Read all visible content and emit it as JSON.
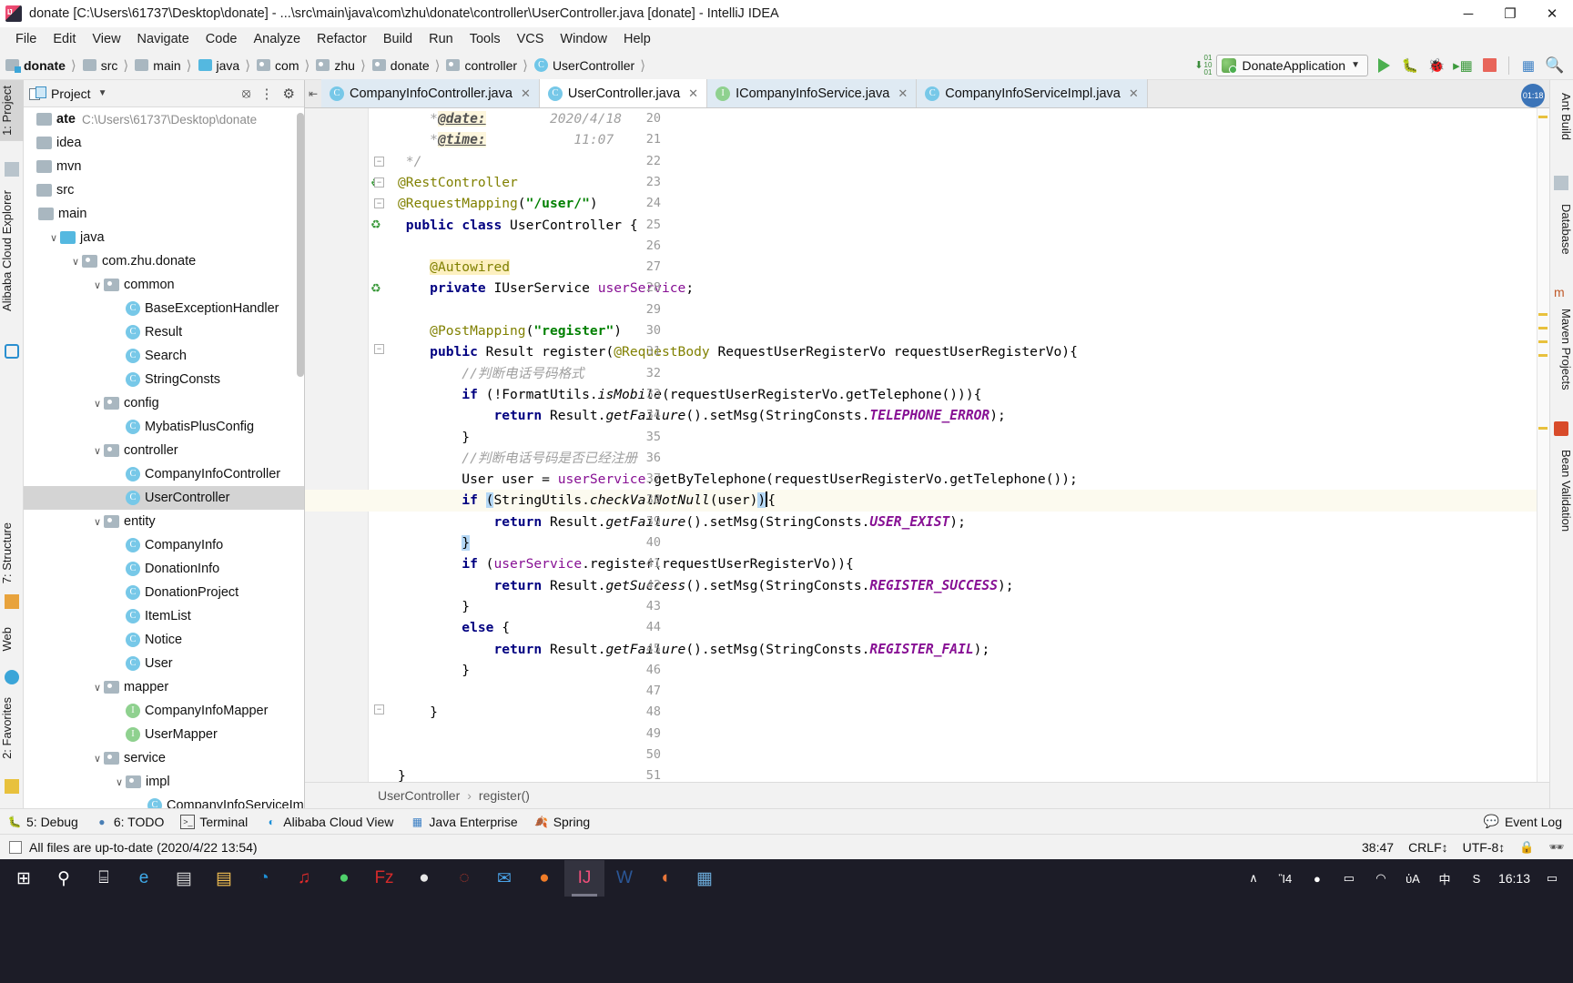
{
  "window": {
    "title": "donate [C:\\Users\\61737\\Desktop\\donate] - ...\\src\\main\\java\\com\\zhu\\donate\\controller\\UserController.java [donate] - IntelliJ IDEA",
    "minimize": "─",
    "maximize": "❐",
    "close": "✕"
  },
  "menu": [
    {
      "label": "File"
    },
    {
      "label": "Edit"
    },
    {
      "label": "View"
    },
    {
      "label": "Navigate"
    },
    {
      "label": "Code"
    },
    {
      "label": "Analyze"
    },
    {
      "label": "Refactor"
    },
    {
      "label": "Build"
    },
    {
      "label": "Run"
    },
    {
      "label": "Tools"
    },
    {
      "label": "VCS"
    },
    {
      "label": "Window"
    },
    {
      "label": "Help"
    }
  ],
  "breadcrumbs": [
    {
      "label": "donate",
      "icon": "folder-module-icon",
      "bold": true
    },
    {
      "label": "src",
      "icon": "folder-icon",
      "bold": false
    },
    {
      "label": "main",
      "icon": "folder-icon",
      "bold": false
    },
    {
      "label": "java",
      "icon": "folder-source-icon",
      "bold": false
    },
    {
      "label": "com",
      "icon": "package-icon",
      "bold": false
    },
    {
      "label": "zhu",
      "icon": "package-icon",
      "bold": false
    },
    {
      "label": "donate",
      "icon": "package-icon",
      "bold": false
    },
    {
      "label": "controller",
      "icon": "package-icon",
      "bold": false
    },
    {
      "label": "UserController",
      "icon": "class-icon",
      "bold": false
    }
  ],
  "toolbar": {
    "run_config": "DonateApplication",
    "run": "Run",
    "debug": "Debug",
    "coverage": "Run with Coverage",
    "profile": "Profiler",
    "stop": "Stop",
    "layout": "Layout",
    "search": "Search Everywhere"
  },
  "project_panel": {
    "title": "Project",
    "tree": [
      {
        "label": "ate",
        "path": "C:\\Users\\61737\\Desktop\\donate",
        "icon": "folder-module-icon",
        "arrow": "",
        "indent": 0,
        "bold": true
      },
      {
        "label": "idea",
        "path": "",
        "icon": "folder-icon",
        "arrow": "",
        "indent": 0,
        "bold": false
      },
      {
        "label": "mvn",
        "path": "",
        "icon": "folder-icon",
        "arrow": "",
        "indent": 0,
        "bold": false
      },
      {
        "label": "src",
        "path": "",
        "icon": "folder-icon",
        "arrow": "",
        "indent": 0,
        "bold": false
      },
      {
        "label": "main",
        "path": "",
        "icon": "folder-icon",
        "arrow": "",
        "indent": 1,
        "bold": false
      },
      {
        "label": "java",
        "path": "",
        "icon": "folder-source-icon",
        "arrow": "∨",
        "indent": 2,
        "bold": false
      },
      {
        "label": "com.zhu.donate",
        "path": "",
        "icon": "package-icon",
        "arrow": "∨",
        "indent": 3,
        "bold": false
      },
      {
        "label": "common",
        "path": "",
        "icon": "package-icon",
        "arrow": "∨",
        "indent": 4,
        "bold": false
      },
      {
        "label": "BaseExceptionHandler",
        "path": "",
        "icon": "class-icon",
        "arrow": "",
        "indent": 5,
        "bold": false
      },
      {
        "label": "Result",
        "path": "",
        "icon": "class-icon",
        "arrow": "",
        "indent": 5,
        "bold": false
      },
      {
        "label": "Search",
        "path": "",
        "icon": "class-icon",
        "arrow": "",
        "indent": 5,
        "bold": false
      },
      {
        "label": "StringConsts",
        "path": "",
        "icon": "class-icon",
        "arrow": "",
        "indent": 5,
        "bold": false
      },
      {
        "label": "config",
        "path": "",
        "icon": "package-icon",
        "arrow": "∨",
        "indent": 4,
        "bold": false
      },
      {
        "label": "MybatisPlusConfig",
        "path": "",
        "icon": "class-icon",
        "arrow": "",
        "indent": 5,
        "bold": false
      },
      {
        "label": "controller",
        "path": "",
        "icon": "package-icon",
        "arrow": "∨",
        "indent": 4,
        "bold": false
      },
      {
        "label": "CompanyInfoController",
        "path": "",
        "icon": "class-icon",
        "arrow": "",
        "indent": 5,
        "bold": false
      },
      {
        "label": "UserController",
        "path": "",
        "icon": "class-icon",
        "arrow": "",
        "indent": 5,
        "bold": false,
        "selected": true
      },
      {
        "label": "entity",
        "path": "",
        "icon": "package-icon",
        "arrow": "∨",
        "indent": 4,
        "bold": false
      },
      {
        "label": "CompanyInfo",
        "path": "",
        "icon": "class-icon",
        "arrow": "",
        "indent": 5,
        "bold": false
      },
      {
        "label": "DonationInfo",
        "path": "",
        "icon": "class-icon",
        "arrow": "",
        "indent": 5,
        "bold": false
      },
      {
        "label": "DonationProject",
        "path": "",
        "icon": "class-icon",
        "arrow": "",
        "indent": 5,
        "bold": false
      },
      {
        "label": "ItemList",
        "path": "",
        "icon": "class-icon",
        "arrow": "",
        "indent": 5,
        "bold": false
      },
      {
        "label": "Notice",
        "path": "",
        "icon": "class-icon",
        "arrow": "",
        "indent": 5,
        "bold": false
      },
      {
        "label": "User",
        "path": "",
        "icon": "class-icon",
        "arrow": "",
        "indent": 5,
        "bold": false
      },
      {
        "label": "mapper",
        "path": "",
        "icon": "package-icon",
        "arrow": "∨",
        "indent": 4,
        "bold": false
      },
      {
        "label": "CompanyInfoMapper",
        "path": "",
        "icon": "interface-icon",
        "arrow": "",
        "indent": 5,
        "bold": false
      },
      {
        "label": "UserMapper",
        "path": "",
        "icon": "interface-icon",
        "arrow": "",
        "indent": 5,
        "bold": false
      },
      {
        "label": "service",
        "path": "",
        "icon": "package-icon",
        "arrow": "∨",
        "indent": 4,
        "bold": false
      },
      {
        "label": "impl",
        "path": "",
        "icon": "package-icon",
        "arrow": "∨",
        "indent": 5,
        "bold": false
      },
      {
        "label": "CompanyInfoServiceIm",
        "path": "",
        "icon": "class-icon",
        "arrow": "",
        "indent": 6,
        "bold": false
      }
    ]
  },
  "left_tool_strip": [
    {
      "label": "1: Project",
      "active": true
    },
    {
      "label": "Alibaba Cloud Explorer",
      "active": false
    },
    {
      "label": "7: Structure",
      "active": false
    },
    {
      "label": "Web",
      "active": false
    },
    {
      "label": "2: Favorites",
      "active": false
    }
  ],
  "right_tool_strip": [
    {
      "label": "Ant Build"
    },
    {
      "label": "Database"
    },
    {
      "label": "Maven Projects"
    },
    {
      "label": "Bean Validation"
    }
  ],
  "editor_tabs": [
    {
      "label": "CompanyInfoController.java",
      "kind": "class-icon",
      "active": false
    },
    {
      "label": "UserController.java",
      "kind": "class-icon",
      "active": true
    },
    {
      "label": "ICompanyInfoService.java",
      "kind": "interface-icon",
      "active": false
    },
    {
      "label": "CompanyInfoServiceImpl.java",
      "kind": "class-icon",
      "active": false
    }
  ],
  "editor_badges": {
    "time": "01:18",
    "warnings": "4"
  },
  "code": {
    "first_line": 20,
    "caret_line": 38,
    "lines": [
      {
        "n": 20,
        "html": "    <span class='doc'>*</span><span class='doctag'>@date:</span><span class='doc'>        2020/4/18</span>"
      },
      {
        "n": 21,
        "html": "    <span class='doc'>*</span><span class='doctag'>@time:</span><span class='doc'>           11:07</span>"
      },
      {
        "n": 22,
        "html": " <span class='doc'>*/</span>"
      },
      {
        "n": 23,
        "html": "<span class='ann'>@RestController</span>"
      },
      {
        "n": 24,
        "html": "<span class='ann'>@RequestMapping</span>(<span class='str'>\"/user/\"</span>)"
      },
      {
        "n": 25,
        "html": " <span class='kw'>public</span> <span class='kw'>class</span> UserController {"
      },
      {
        "n": 26,
        "html": ""
      },
      {
        "n": 27,
        "html": "    <span class='ann hl-ann'>@Autowired</span>"
      },
      {
        "n": 28,
        "html": "    <span class='kw'>private</span> IUserService <span class='fld'>userService</span>;"
      },
      {
        "n": 29,
        "html": ""
      },
      {
        "n": 30,
        "html": "    <span class='ann'>@PostMapping</span>(<span class='str'>\"register\"</span>)"
      },
      {
        "n": 31,
        "html": "    <span class='kw'>public</span> Result register(<span class='ann'>@RequestBody</span> RequestUserRegisterVo requestUserRegisterVo){"
      },
      {
        "n": 32,
        "html": "        <span class='cmt'>//判断电话号码格式</span>"
      },
      {
        "n": 33,
        "html": "        <span class='kw'>if</span> (!FormatUtils.<span class='mth'>isMobile</span>(requestUserRegisterVo.getTelephone())){"
      },
      {
        "n": 34,
        "html": "            <span class='kw'>return</span> Result.<span class='mth'>getFailure</span>().setMsg(StringConsts.<span class='cst'>TELEPHONE_ERROR</span>);"
      },
      {
        "n": 35,
        "html": "        }"
      },
      {
        "n": 36,
        "html": "        <span class='cmt'>//判断电话号码是否已经注册</span>"
      },
      {
        "n": 37,
        "html": "        User user = <span class='fld'>userService</span>.getByTelephone(requestUserRegisterVo.getTelephone());"
      },
      {
        "n": 38,
        "html": "        <span class='kw'>if</span> <span class='hl-brk'>(</span>StringUtils.<span class='mth'>checkValNotNull</span>(user)<span class='hl-brk'>)</span><span class='caret-bar'></span>{"
      },
      {
        "n": 39,
        "html": "            <span class='kw'>return</span> Result.<span class='mth'>getFailure</span>().setMsg(StringConsts.<span class='cst'>USER_EXIST</span>);"
      },
      {
        "n": 40,
        "html": "        <span class='hl-brk'>}</span>"
      },
      {
        "n": 41,
        "html": "        <span class='kw'>if</span> (<span class='fld'>userService</span>.register(requestUserRegisterVo)){"
      },
      {
        "n": 42,
        "html": "            <span class='kw'>return</span> Result.<span class='mth'>getSuccess</span>().setMsg(StringConsts.<span class='cst'>REGISTER_SUCCESS</span>);"
      },
      {
        "n": 43,
        "html": "        }"
      },
      {
        "n": 44,
        "html": "        <span class='kw'>else</span> {"
      },
      {
        "n": 45,
        "html": "            <span class='kw'>return</span> Result.<span class='mth'>getFailure</span>().setMsg(StringConsts.<span class='cst'>REGISTER_FAIL</span>);"
      },
      {
        "n": 46,
        "html": "        }"
      },
      {
        "n": 47,
        "html": ""
      },
      {
        "n": 48,
        "html": "    }"
      },
      {
        "n": 49,
        "html": ""
      },
      {
        "n": 50,
        "html": ""
      },
      {
        "n": 51,
        "html": "}"
      }
    ]
  },
  "code_breadcrumb": {
    "class": "UserController",
    "method": "register()",
    "sep": "›"
  },
  "bottom_tools": [
    {
      "label": "5: Debug",
      "icon": "bug-icon"
    },
    {
      "label": "6: TODO",
      "icon": "todo-icon"
    },
    {
      "label": "Terminal",
      "icon": "terminal-icon"
    },
    {
      "label": "Alibaba Cloud View",
      "icon": "cloud-icon"
    },
    {
      "label": "Java Enterprise",
      "icon": "java-ee-icon"
    },
    {
      "label": "Spring",
      "icon": "spring-leaf-icon"
    }
  ],
  "event_log": {
    "label": "Event Log",
    "icon": "speech-bubble-icon"
  },
  "status": {
    "message": "All files are up-to-date (2020/4/22 13:54)",
    "caret_position": "38:47",
    "line_separator": "CRLF",
    "encoding": "UTF-8",
    "readonly_icon": "lock-icon",
    "inspection_icon": "inspector-icon"
  },
  "taskbar": {
    "items": [
      {
        "name": "start-button",
        "glyph": "⊞",
        "color": "#ffffff"
      },
      {
        "name": "search-icon",
        "glyph": "⚲",
        "color": "#ffffff"
      },
      {
        "name": "task-view-icon",
        "glyph": "⌸",
        "color": "#ffffff"
      },
      {
        "name": "edge-icon",
        "glyph": "e",
        "color": "#3fa9e8"
      },
      {
        "name": "store-icon",
        "glyph": "▤",
        "color": "#d8d8d8"
      },
      {
        "name": "explorer-icon",
        "glyph": "▤",
        "color": "#f4c152"
      },
      {
        "name": "qq-browser-icon",
        "glyph": "◔",
        "color": "#1e90d6"
      },
      {
        "name": "netease-music-icon",
        "glyph": "♫",
        "color": "#e02b2b"
      },
      {
        "name": "wechat-icon",
        "glyph": "●",
        "color": "#4fd06b"
      },
      {
        "name": "filezilla-icon",
        "glyph": "Fz",
        "color": "#d42a2a"
      },
      {
        "name": "qq-icon",
        "glyph": "●",
        "color": "#e8e8e8"
      },
      {
        "name": "snail-icon",
        "glyph": "◌",
        "color": "#c0392b"
      },
      {
        "name": "foxmail-icon",
        "glyph": "✉",
        "color": "#4aa3e8"
      },
      {
        "name": "clementine-icon",
        "glyph": "●",
        "color": "#f07c28"
      },
      {
        "name": "intellij-idea-icon",
        "glyph": "IJ",
        "color": "#f04f7a",
        "active": true
      },
      {
        "name": "word-icon",
        "glyph": "W",
        "color": "#2b5797"
      },
      {
        "name": "firefox-icon",
        "glyph": "◖",
        "color": "#e8763a"
      },
      {
        "name": "app-icon",
        "glyph": "▦",
        "color": "#6aa9d8"
      }
    ],
    "tray": [
      {
        "name": "show-hidden-icons",
        "glyph": "∧"
      },
      {
        "name": "microphone-icon",
        "glyph": "Ἲ4"
      },
      {
        "name": "wechat-tray-icon",
        "glyph": "●"
      },
      {
        "name": "battery-icon",
        "glyph": "▭"
      },
      {
        "name": "wifi-icon",
        "glyph": "◠"
      },
      {
        "name": "volume-icon",
        "glyph": "ὐA"
      },
      {
        "name": "ime-icon",
        "glyph": "中"
      },
      {
        "name": "sogou-icon",
        "glyph": "S"
      }
    ],
    "clock": "16:13",
    "notifications_icon": "notification-icon"
  }
}
